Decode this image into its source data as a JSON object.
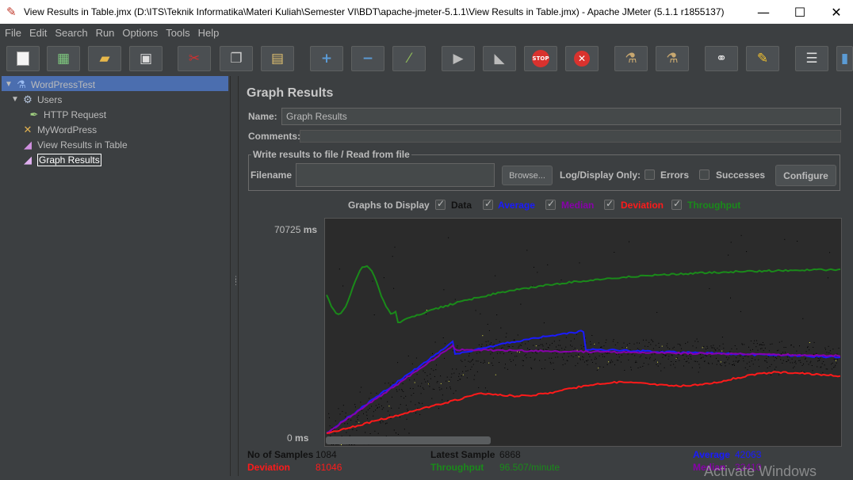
{
  "window": {
    "title": "View Results in Table.jmx (D:\\ITS\\Teknik Informatika\\Materi Kuliah\\Semester VI\\BDT\\apache-jmeter-5.1.1\\View Results in Table.jmx) - Apache JMeter (5.1.1 r1855137)"
  },
  "menu": [
    "File",
    "Edit",
    "Search",
    "Run",
    "Options",
    "Tools",
    "Help"
  ],
  "toolbar": [
    "new-icon",
    "templates-icon",
    "open-icon",
    "save-icon",
    "cut-icon",
    "copy-icon",
    "paste-icon",
    "expand-icon",
    "collapse-icon",
    "toggle-icon",
    "start-icon",
    "start-no-pause-icon",
    "stop-icon",
    "shutdown-icon",
    "clear-icon",
    "clear-all-icon",
    "search-icon",
    "reset-search-icon",
    "function-helper-icon",
    "help-icon"
  ],
  "tree": {
    "items": [
      {
        "label": "WordPressTest",
        "icon": "flask-icon"
      },
      {
        "label": "Users",
        "icon": "gear-icon"
      },
      {
        "label": "HTTP Request",
        "icon": "pipette-icon"
      },
      {
        "label": "MyWordPress",
        "icon": "tools-icon"
      },
      {
        "label": "View Results in Table",
        "icon": "chart-icon"
      },
      {
        "label": "Graph Results",
        "icon": "chart-icon"
      }
    ]
  },
  "panel": {
    "title": "Graph Results",
    "name_label": "Name:",
    "name_value": "Graph Results",
    "comments_label": "Comments:",
    "file_group": "Write results to file / Read from file",
    "filename_label": "Filename",
    "browse": "Browse...",
    "log_display": "Log/Display Only:",
    "errors": "Errors",
    "successes": "Successes",
    "configure": "Configure",
    "graphs_to_display": "Graphs to Display"
  },
  "toggles": [
    {
      "label": "Data",
      "color": "#000000"
    },
    {
      "label": "Average",
      "color": "#0000ff"
    },
    {
      "label": "Median",
      "color": "#8000a0"
    },
    {
      "label": "Deviation",
      "color": "#ff0000"
    },
    {
      "label": "Throughput",
      "color": "#008000"
    }
  ],
  "chart_data": {
    "type": "line",
    "ylabel": "ms",
    "ymax_label": "70725",
    "ymin_label": "0",
    "ylim": [
      0,
      70725
    ],
    "series": [
      {
        "name": "Average",
        "color": "#1a1aff"
      },
      {
        "name": "Median",
        "color": "#8800aa"
      },
      {
        "name": "Deviation",
        "color": "#ff1a1a"
      },
      {
        "name": "Throughput",
        "color": "#1a8a1a"
      }
    ]
  },
  "stats": {
    "samples_label": "No of Samples",
    "samples_value": "1084",
    "latest_label": "Latest Sample",
    "latest_value": "6868",
    "average_label": "Average",
    "average_value": "42063",
    "deviation_label": "Deviation",
    "deviation_value": "81046",
    "throughput_label": "Throughput",
    "throughput_value": "96.507/minute",
    "median_label": "Median",
    "median_value": "32410"
  },
  "watermark": "Activate Windows"
}
